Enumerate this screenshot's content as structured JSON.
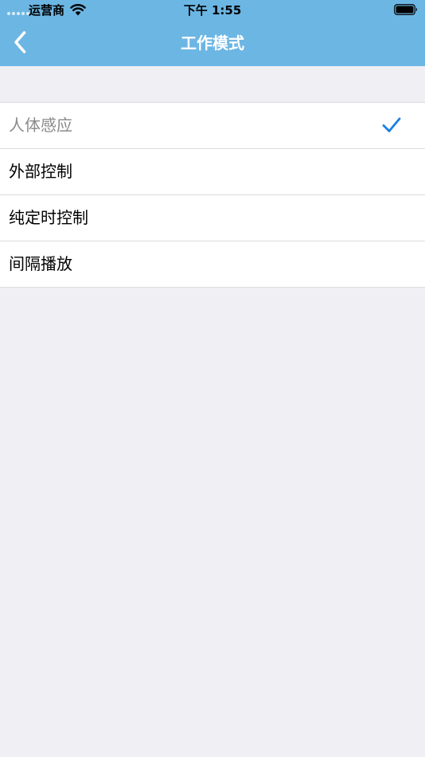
{
  "status_bar": {
    "carrier": "运营商",
    "time": "下午 1:55"
  },
  "nav_bar": {
    "title": "工作模式",
    "back_icon": "chevron-left-icon"
  },
  "mode_list": {
    "selected_index": 0,
    "items": [
      {
        "label": "人体感应",
        "selected": true
      },
      {
        "label": "外部控制",
        "selected": false
      },
      {
        "label": "纯定时控制",
        "selected": false
      },
      {
        "label": "间隔播放",
        "selected": false
      }
    ]
  },
  "colors": {
    "nav_background": "#6cb6e3",
    "page_background": "#efeff4",
    "checkmark": "#1a7ee6",
    "selected_text": "#8a8a8a"
  }
}
